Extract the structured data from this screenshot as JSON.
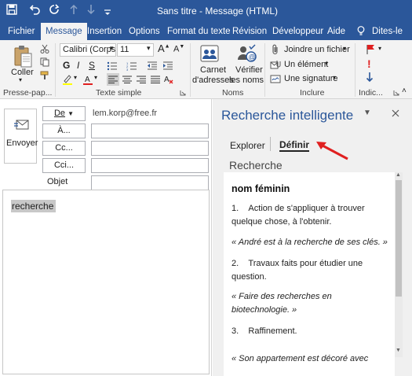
{
  "window": {
    "title": "Sans titre  -  Message (HTML)"
  },
  "menu": {
    "tabs": [
      "Fichier",
      "Message",
      "Insertion",
      "Options",
      "Format du texte",
      "Révision",
      "Développeur",
      "Aide",
      "Dites-le"
    ],
    "active": "Message"
  },
  "ribbon": {
    "clipboard": {
      "paste_label": "Coller",
      "group_label": "Presse-pap..."
    },
    "basic_text": {
      "font_name": "Calibri (Corps",
      "font_size": "11",
      "group_label": "Texte simple"
    },
    "names": {
      "address_book_line1": "Carnet",
      "address_book_line2": "d'adresses",
      "check_names_line1": "Vérifier",
      "check_names_line2": "les noms",
      "group_label": "Noms"
    },
    "include": {
      "attach_file": "Joindre un fichier",
      "attach_item": "Un élément",
      "signature": "Une signature",
      "group_label": "Inclure"
    },
    "tags": {
      "group_label": "Indic..."
    }
  },
  "compose": {
    "send_label": "Envoyer",
    "from_label": "De",
    "from_value": "lem.korp@free.fr",
    "to_label": "À...",
    "cc_label": "Cc...",
    "bcc_label": "Cci...",
    "subject_label": "Objet",
    "body_selected_word": "recherche"
  },
  "smart_lookup": {
    "title": "Recherche intelligente",
    "tab_explore": "Explorer",
    "tab_define": "Définir",
    "section": "Recherche",
    "part_of_speech": "nom féminin",
    "definitions": [
      {
        "num": "1.",
        "text": "Action de s'appliquer à trouver quelque chose, à l'obtenir.",
        "example": "« André est à la recherche de ses clés. »"
      },
      {
        "num": "2.",
        "text": "Travaux faits pour étudier une question.",
        "example": "« Faire des recherches en biotechnologie. »"
      },
      {
        "num": "3.",
        "text": "Raffinement.",
        "example": "« Son appartement est décoré avec"
      }
    ]
  },
  "colors": {
    "accent": "#2b579a",
    "annotation_arrow": "#e02020",
    "font_color_swatch": "#e02020",
    "highlight_swatch": "#ffff00"
  }
}
